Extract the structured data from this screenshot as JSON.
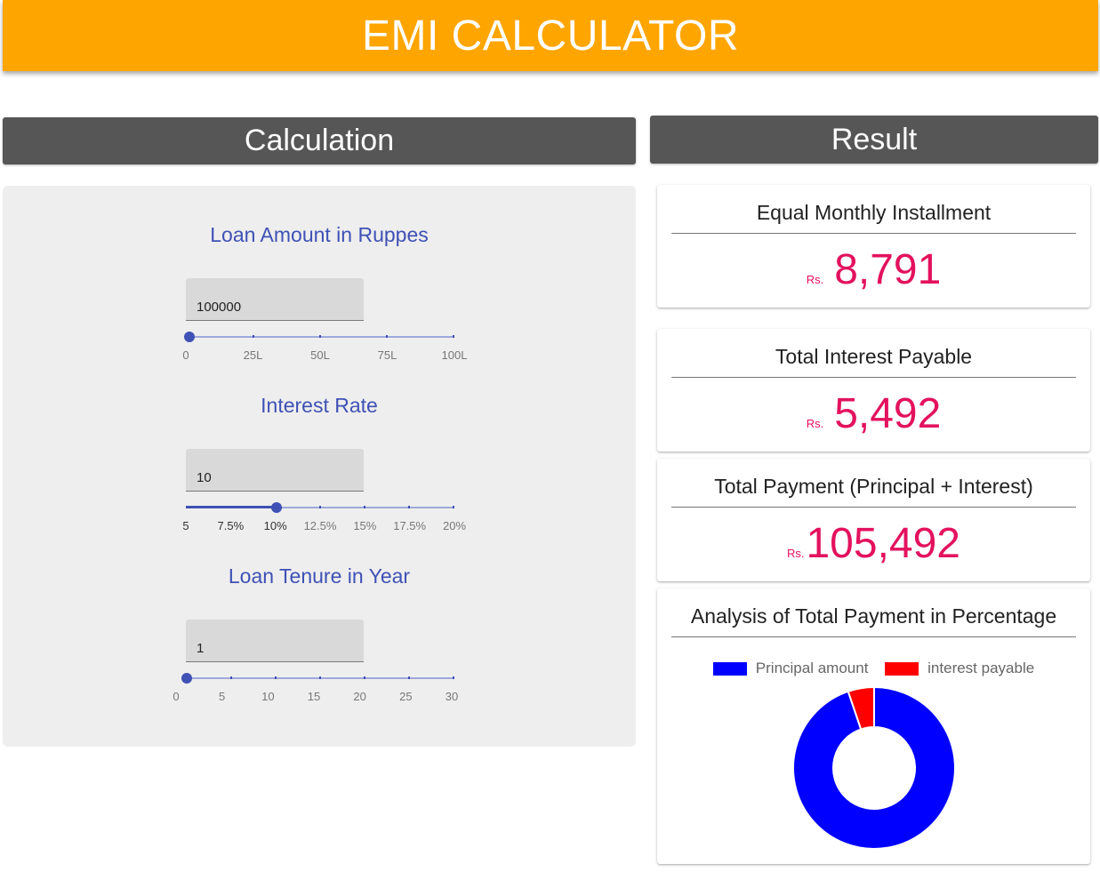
{
  "app": {
    "title": "EMI CALCULATOR"
  },
  "calculation": {
    "header": "Calculation",
    "loan_amount": {
      "title": "Loan Amount in Ruppes",
      "value": "100000",
      "slider_value_fraction": 0.01,
      "ticks": [
        "0",
        "25L",
        "50L",
        "75L",
        "100L"
      ]
    },
    "interest_rate": {
      "title": "Interest Rate",
      "value": "10",
      "slider_value_fraction": 0.333,
      "ticks": [
        "5",
        "7.5%",
        "10%",
        "12.5%",
        "15%",
        "17.5%",
        "20%"
      ],
      "active_ticks": [
        0,
        1,
        2
      ]
    },
    "loan_tenure": {
      "title": "Loan Tenure in Year",
      "value": "1",
      "slider_value_fraction": 0.0,
      "ticks": [
        "0",
        "5",
        "10",
        "15",
        "20",
        "25",
        "30"
      ]
    }
  },
  "result": {
    "header": "Result",
    "emi": {
      "title": "Equal Monthly Installment",
      "currency": "Rs.",
      "amount": "8,791"
    },
    "interest": {
      "title": "Total Interest Payable",
      "currency": "Rs.",
      "amount": "5,492"
    },
    "total": {
      "title": "Total Payment (Principal + Interest)",
      "currency": "Rs.",
      "amount": "105,492"
    },
    "analysis": {
      "title": "Analysis of Total Payment in Percentage"
    }
  },
  "colors": {
    "accent": "#ffa500",
    "header_bg": "#565656",
    "primary": "#3f51b5",
    "value": "#e3125e",
    "principal": "#0000ff",
    "interest": "#ff0000"
  },
  "chart_data": {
    "type": "pie",
    "variant": "doughnut",
    "categories": [
      "Principal amount",
      "interest payable"
    ],
    "values": [
      100000,
      5492
    ],
    "colors": [
      "#0000ff",
      "#ff0000"
    ],
    "legend": "top"
  }
}
